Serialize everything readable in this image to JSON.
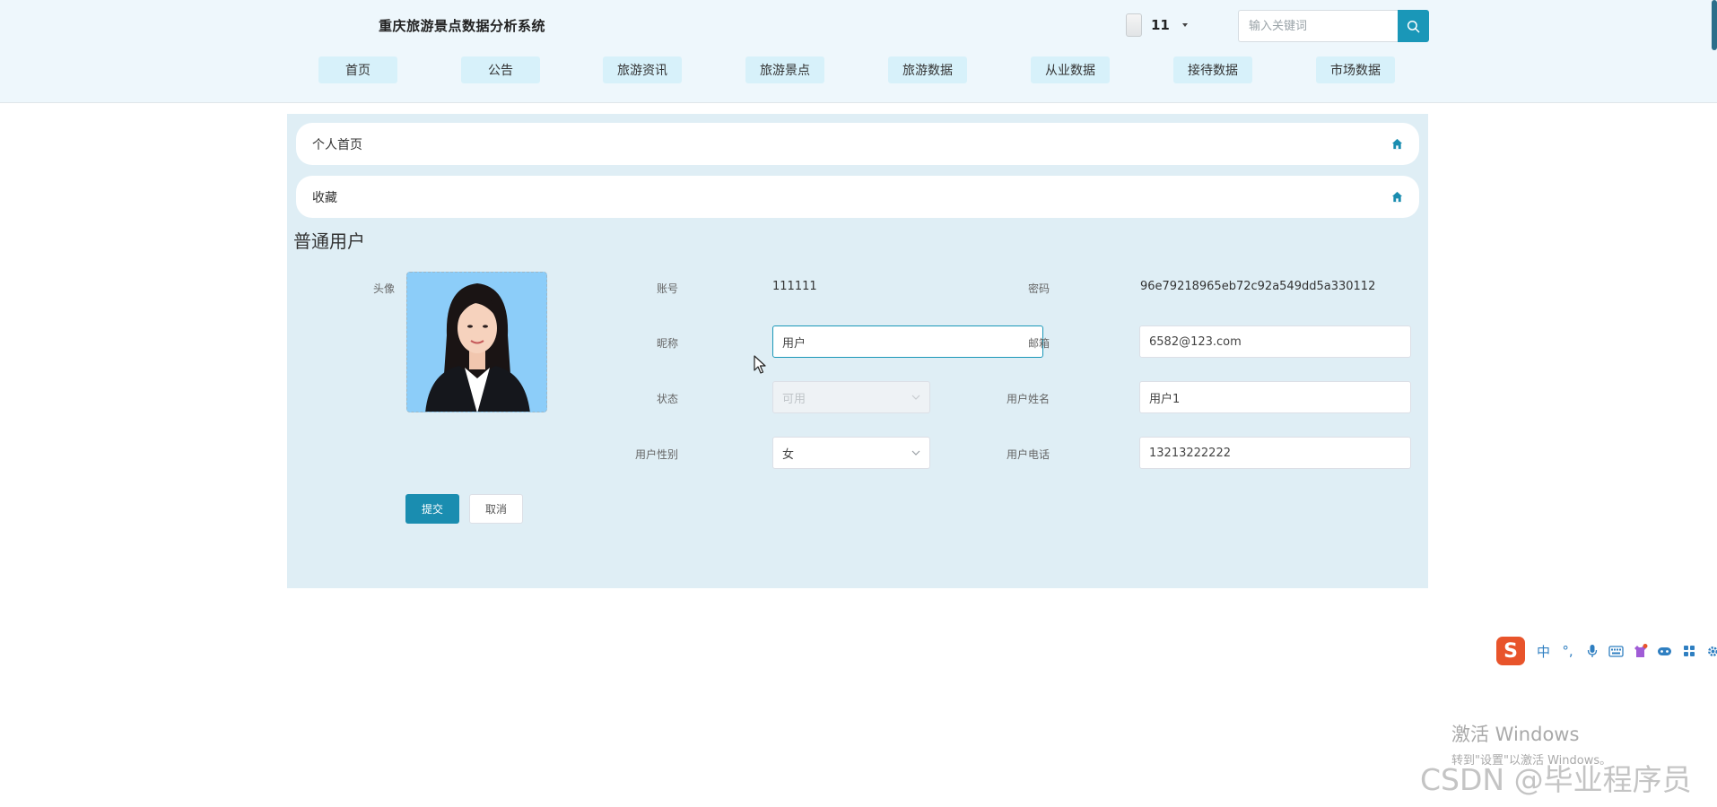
{
  "header": {
    "site_title": "重庆旅游景点数据分析系统",
    "user": {
      "name": "11"
    },
    "search": {
      "placeholder": "输入关键词",
      "value": ""
    },
    "nav_items": [
      {
        "label": "首页"
      },
      {
        "label": "公告"
      },
      {
        "label": "旅游资讯"
      },
      {
        "label": "旅游景点"
      },
      {
        "label": "旅游数据"
      },
      {
        "label": "从业数据"
      },
      {
        "label": "接待数据"
      },
      {
        "label": "市场数据"
      }
    ]
  },
  "menu": [
    {
      "label": "个人首页",
      "icon": "home-icon"
    },
    {
      "label": "收藏",
      "icon": "home-icon"
    }
  ],
  "profile": {
    "section_title": "普通用户",
    "fields": {
      "avatar": {
        "label": "头像"
      },
      "account": {
        "label": "账号",
        "value": "111111"
      },
      "password": {
        "label": "密码",
        "value": "96e79218965eb72c92a549dd5a330112"
      },
      "nickname": {
        "label": "昵称",
        "value": "用户"
      },
      "email": {
        "label": "邮箱",
        "value": "6582@123.com"
      },
      "status": {
        "label": "状态",
        "value": "可用"
      },
      "real_name": {
        "label": "用户姓名",
        "value": "用户1"
      },
      "gender": {
        "label": "用户性别",
        "value": "女"
      },
      "phone": {
        "label": "用户电话",
        "value": "13213222222"
      }
    },
    "buttons": {
      "submit": "提交",
      "cancel": "取消"
    }
  },
  "overlay": {
    "ime_logo": "S",
    "ime_lang": "中",
    "ime_punct": "°,",
    "windows_activation": {
      "title": "激活 Windows",
      "subtitle": "转到\"设置\"以激活 Windows。"
    },
    "watermark": "CSDN @毕业程序员"
  },
  "colors": {
    "header_bg": "#eef7fc",
    "nav_item_bg": "#d7f1fa",
    "panel_bg": "#dfeef5",
    "accent": "#1a97b8",
    "submit_bg": "#1a8db0"
  }
}
